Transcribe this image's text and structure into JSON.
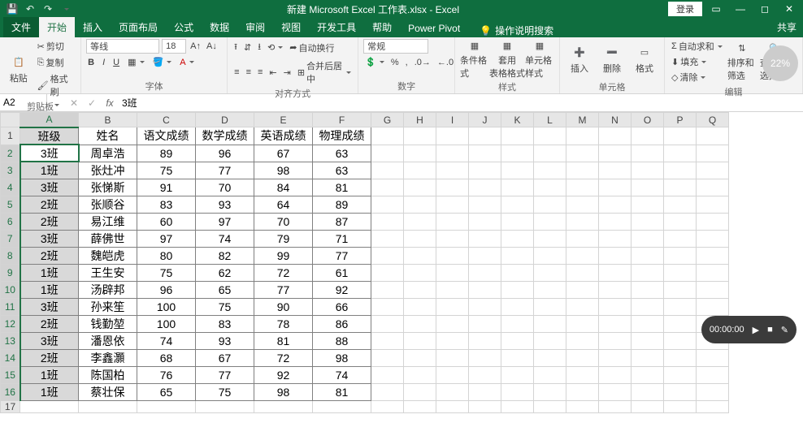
{
  "title": "新建 Microsoft Excel 工作表.xlsx - Excel",
  "login": "登录",
  "tabs": {
    "file": "文件",
    "home": "开始",
    "insert": "插入",
    "layout": "页面布局",
    "formulas": "公式",
    "data": "数据",
    "review": "审阅",
    "view": "视图",
    "dev": "开发工具",
    "help": "帮助",
    "power": "Power Pivot",
    "tellme": "操作说明搜索",
    "share": "共享"
  },
  "ribbon": {
    "clipboard": {
      "paste": "粘贴",
      "cut": "剪切",
      "copy": "复制",
      "painter": "格式刷",
      "label": "剪贴板"
    },
    "font": {
      "name": "等线",
      "size": "18",
      "label": "字体"
    },
    "align": {
      "wrap": "自动换行",
      "merge": "合并后居中",
      "label": "对齐方式"
    },
    "number": {
      "format": "常规",
      "label": "数字"
    },
    "styles": {
      "cond": "条件格式",
      "table": "套用\n表格格式",
      "cell": "单元格样式",
      "label": "样式"
    },
    "cells": {
      "insert": "插入",
      "delete": "删除",
      "format": "格式",
      "label": "单元格"
    },
    "editing": {
      "sum": "自动求和",
      "fill": "填充",
      "clear": "清除",
      "sort": "排序和筛选",
      "find": "查找和选择",
      "label": "编辑"
    },
    "pct": "22%"
  },
  "fx": {
    "name_box": "A2",
    "formula": "3班"
  },
  "columns": [
    "A",
    "B",
    "C",
    "D",
    "E",
    "F",
    "G",
    "H",
    "I",
    "J",
    "K",
    "L",
    "M",
    "N",
    "O",
    "P",
    "Q"
  ],
  "chart_data": {
    "type": "table",
    "headers": [
      "班级",
      "姓名",
      "语文成绩",
      "数学成绩",
      "英语成绩",
      "物理成绩"
    ],
    "rows": [
      [
        "3班",
        "周卓浩",
        89,
        96,
        67,
        63
      ],
      [
        "1班",
        "张灶冲",
        75,
        77,
        98,
        63
      ],
      [
        "3班",
        "张悌斯",
        91,
        70,
        84,
        81
      ],
      [
        "2班",
        "张顺谷",
        83,
        93,
        64,
        89
      ],
      [
        "2班",
        "易江维",
        60,
        97,
        70,
        87
      ],
      [
        "3班",
        "薛佛世",
        97,
        74,
        79,
        71
      ],
      [
        "2班",
        "魏皑虎",
        80,
        82,
        99,
        77
      ],
      [
        "1班",
        "王生安",
        75,
        62,
        72,
        61
      ],
      [
        "1班",
        "汤辟邦",
        96,
        65,
        77,
        92
      ],
      [
        "3班",
        "孙来笙",
        100,
        75,
        90,
        66
      ],
      [
        "2班",
        "钱勤堃",
        100,
        83,
        78,
        86
      ],
      [
        "3班",
        "潘恩依",
        74,
        93,
        81,
        88
      ],
      [
        "2班",
        "李鑫灝",
        68,
        67,
        72,
        98
      ],
      [
        "1班",
        "陈国柏",
        76,
        77,
        92,
        74
      ],
      [
        "1班",
        "蔡壮保",
        65,
        75,
        98,
        81
      ]
    ]
  },
  "rec": {
    "time": "00:00:00"
  }
}
